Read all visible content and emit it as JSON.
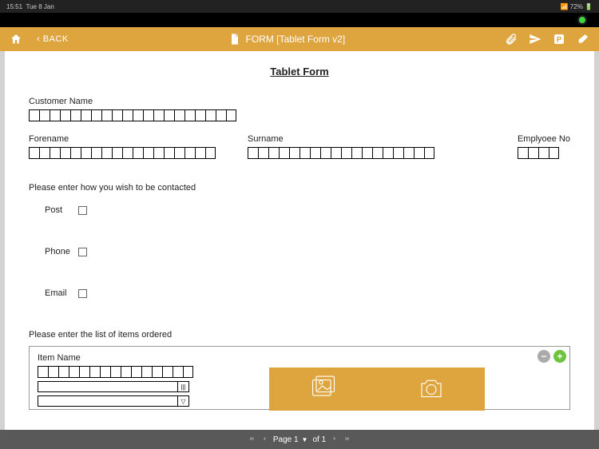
{
  "status": {
    "time": "15:51",
    "date": "Tue 8 Jan",
    "battery": "72%"
  },
  "toolbar": {
    "back": "BACK",
    "title": "FORM [Tablet Form v2]"
  },
  "form": {
    "title": "Tablet Form",
    "customerName": {
      "label": "Customer Name",
      "cells": 20
    },
    "forename": {
      "label": "Forename",
      "cells": 18
    },
    "surname": {
      "label": "Surname",
      "cells": 18
    },
    "employeeNo": {
      "label": "Emplyoee No",
      "cells": 4
    },
    "contactPrompt": "Please enter how you wish to be contacted",
    "contact": {
      "post": "Post",
      "phone": "Phone",
      "email": "Email"
    },
    "itemsPrompt": "Please enter the list of items ordered",
    "items": {
      "nameLabel": "Item Name",
      "nameCells": 15
    }
  },
  "pager": {
    "current": "Page 1",
    "total": "of  1"
  }
}
